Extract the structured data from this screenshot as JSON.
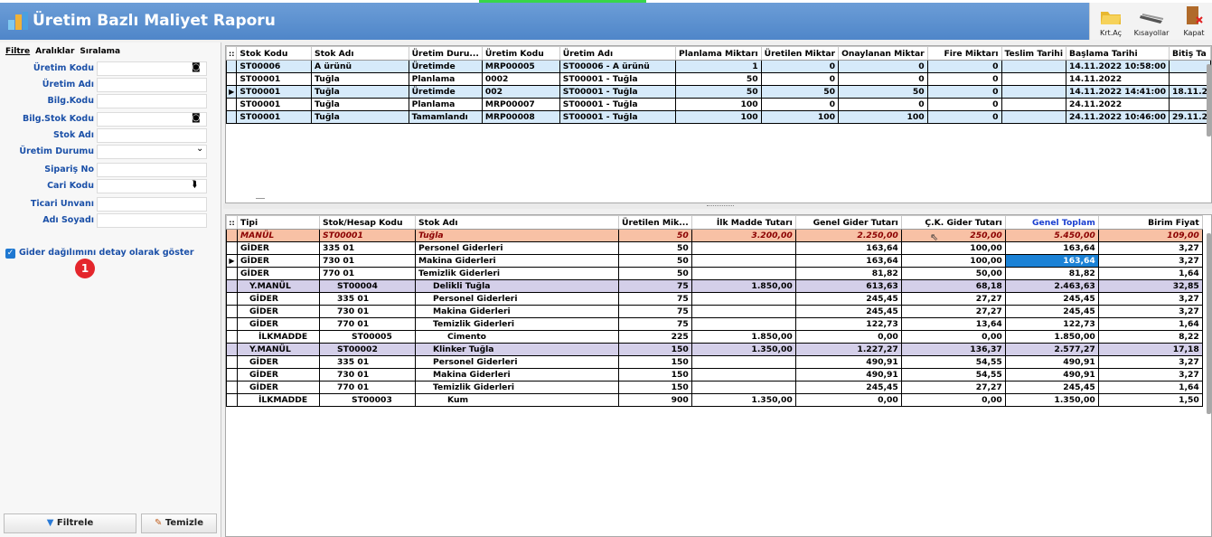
{
  "window": {
    "title": "Üretim Bazlı Maliyet Raporu"
  },
  "toolbar": {
    "krt_ac": "Krt.Aç",
    "kisayollar": "Kısayollar",
    "kapat": "Kapat"
  },
  "left_tabs": [
    "Filtre",
    "Aralıklar",
    "Sıralama"
  ],
  "filters": [
    {
      "label": "Üretim Kodu",
      "value": "",
      "button": "binoculars-icon"
    },
    {
      "label": "Üretim Adı",
      "value": ""
    },
    {
      "label": "Bilg.Kodu",
      "value": ""
    },
    {
      "label": "Bilg.Stok Kodu",
      "value": "",
      "button": "binoculars-icon"
    },
    {
      "label": "Stok Adı",
      "value": ""
    },
    {
      "label": "Üretim Durumu",
      "value": "",
      "dropdown": true
    },
    {
      "label": "Sipariş No",
      "value": ""
    },
    {
      "label": "Cari Kodu",
      "value": "",
      "button": "lookup-icon"
    },
    {
      "label": "Ticari Unvanı",
      "value": ""
    },
    {
      "label": "Adı Soyadı",
      "value": ""
    }
  ],
  "detail_checkbox": {
    "label": "Gider dağılımını detay olarak göster",
    "checked": true
  },
  "callout": "1",
  "buttons": {
    "filtrele": "Filtrele",
    "temizle": "Temizle"
  },
  "top_grid": {
    "corner": "::",
    "headers": [
      "Stok Kodu",
      "Stok Adı",
      "Üretim Duru...",
      "Üretim Kodu",
      "Üretim Adı",
      "Planlama Miktarı",
      "Üretilen Miktar",
      "Onaylanan Miktar",
      "Fire Miktarı",
      "Teslim Tarihi",
      "Başlama Tarihi",
      "Bitiş Ta"
    ],
    "rows": [
      {
        "style": "blue",
        "ind": "",
        "cells": [
          "ST00006",
          "A ürünü",
          "Üretimde",
          "MRP00005",
          "ST00006 - A ürünü",
          "1",
          "0",
          "0",
          "0",
          "",
          "14.11.2022 10:58:00",
          ""
        ]
      },
      {
        "style": "white",
        "ind": "",
        "cells": [
          "ST00001",
          "Tuğla",
          "Planlama",
          "0002",
          "ST00001 - Tuğla",
          "50",
          "0",
          "0",
          "0",
          "",
          "14.11.2022",
          ""
        ]
      },
      {
        "style": "blue",
        "ind": "▶",
        "cells": [
          "ST00001",
          "Tuğla",
          "Üretimde",
          "002",
          "ST00001 - Tuğla",
          "50",
          "50",
          "50",
          "0",
          "",
          "14.11.2022 14:41:00",
          "18.11.2"
        ]
      },
      {
        "style": "white",
        "ind": "",
        "cells": [
          "ST00001",
          "Tuğla",
          "Planlama",
          "MRP00007",
          "ST00001 - Tuğla",
          "100",
          "0",
          "0",
          "0",
          "",
          "24.11.2022",
          ""
        ]
      },
      {
        "style": "blue",
        "ind": "",
        "cells": [
          "ST00001",
          "Tuğla",
          "Tamamlandı",
          "MRP00008",
          "ST00001 - Tuğla",
          "100",
          "100",
          "100",
          "0",
          "",
          "24.11.2022 10:46:00",
          "29.11.2"
        ]
      }
    ]
  },
  "bottom_grid": {
    "corner": "::",
    "headers": [
      "Tipi",
      "Stok/Hesap Kodu",
      "Stok Adı",
      "Üretilen Mik...",
      "İlk Madde Tutarı",
      "Genel Gider Tutarı",
      "Ç.K. Gider Tutarı",
      "Genel Toplam",
      "Birim Fiyat"
    ],
    "rows": [
      {
        "style": "orange",
        "ind": "",
        "indent": 0,
        "cells": [
          "MANÜL",
          "ST00001",
          "Tuğla",
          "50",
          "3.200,00",
          "2.250,00",
          "250,00",
          "5.450,00",
          "109,00"
        ]
      },
      {
        "style": "white",
        "ind": "",
        "indent": 0,
        "cells": [
          "GİDER",
          "335 01",
          "Personel Giderleri",
          "50",
          "",
          "163,64",
          "100,00",
          "163,64",
          "3,27"
        ]
      },
      {
        "style": "white",
        "ind": "▶",
        "indent": 0,
        "cells": [
          "GİDER",
          "730 01",
          "Makina Giderleri",
          "50",
          "",
          "163,64",
          "100,00",
          "163,64",
          "3,27"
        ]
      },
      {
        "style": "white",
        "ind": "",
        "indent": 0,
        "cells": [
          "GİDER",
          "770 01",
          "Temizlik Giderleri",
          "50",
          "",
          "81,82",
          "50,00",
          "81,82",
          "1,64"
        ]
      },
      {
        "style": "purple",
        "ind": "",
        "indent": 1,
        "cells": [
          "Y.MANÜL",
          "ST00004",
          "Delikli Tuğla",
          "75",
          "1.850,00",
          "613,63",
          "68,18",
          "2.463,63",
          "32,85"
        ]
      },
      {
        "style": "white",
        "ind": "",
        "indent": 1,
        "cells": [
          "GİDER",
          "335 01",
          "Personel Giderleri",
          "75",
          "",
          "245,45",
          "27,27",
          "245,45",
          "3,27"
        ]
      },
      {
        "style": "white",
        "ind": "",
        "indent": 1,
        "cells": [
          "GİDER",
          "730 01",
          "Makina Giderleri",
          "75",
          "",
          "245,45",
          "27,27",
          "245,45",
          "3,27"
        ]
      },
      {
        "style": "white",
        "ind": "",
        "indent": 1,
        "cells": [
          "GİDER",
          "770 01",
          "Temizlik Giderleri",
          "75",
          "",
          "122,73",
          "13,64",
          "122,73",
          "1,64"
        ]
      },
      {
        "style": "white",
        "ind": "",
        "indent": 2,
        "cells": [
          "İLKMADDE",
          "ST00005",
          "Cimento",
          "225",
          "1.850,00",
          "0,00",
          "0,00",
          "1.850,00",
          "8,22"
        ]
      },
      {
        "style": "purple",
        "ind": "",
        "indent": 1,
        "cells": [
          "Y.MANÜL",
          "ST00002",
          "Klinker Tuğla",
          "150",
          "1.350,00",
          "1.227,27",
          "136,37",
          "2.577,27",
          "17,18"
        ]
      },
      {
        "style": "white",
        "ind": "",
        "indent": 1,
        "cells": [
          "GİDER",
          "335 01",
          "Personel Giderleri",
          "150",
          "",
          "490,91",
          "54,55",
          "490,91",
          "3,27"
        ]
      },
      {
        "style": "white",
        "ind": "",
        "indent": 1,
        "cells": [
          "GİDER",
          "730 01",
          "Makina Giderleri",
          "150",
          "",
          "490,91",
          "54,55",
          "490,91",
          "3,27"
        ]
      },
      {
        "style": "white",
        "ind": "",
        "indent": 1,
        "cells": [
          "GİDER",
          "770 01",
          "Temizlik Giderleri",
          "150",
          "",
          "245,45",
          "27,27",
          "245,45",
          "1,64"
        ]
      },
      {
        "style": "white",
        "ind": "",
        "indent": 2,
        "cells": [
          "İLKMADDE",
          "ST00003",
          "Kum",
          "900",
          "1.350,00",
          "0,00",
          "0,00",
          "1.350,00",
          "1,50"
        ]
      }
    ]
  },
  "colors": {
    "title_bar": "#5b8fd0",
    "selected_cell": "#1b82d6",
    "manul_row": "#f8c1a5",
    "ymanul_row": "#d4cfe9",
    "label_blue": "#1b50a8"
  }
}
